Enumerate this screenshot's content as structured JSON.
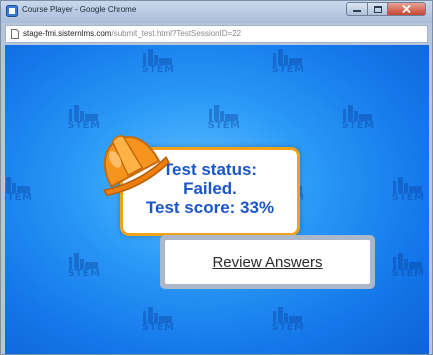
{
  "window": {
    "title": "Course Player - Google Chrome"
  },
  "address_bar": {
    "host": "stage-fmi.sisternlms.com",
    "path": "/submit_test.html?TestSessionID=22"
  },
  "background": {
    "logo_text": "STEM"
  },
  "result": {
    "status_label": "Test status:",
    "status_value": "Failed.",
    "score_text": "Test score: 33%",
    "score_percent": 33
  },
  "actions": {
    "review_label": "Review Answers"
  },
  "colors": {
    "accent_blue": "#1a56c8",
    "card_border": "#f0a21a",
    "background_blue": "#1478ea"
  },
  "icons": {
    "hard_hat": "hard-hat-icon",
    "app": "chrome-app-icon",
    "page": "page-icon"
  }
}
